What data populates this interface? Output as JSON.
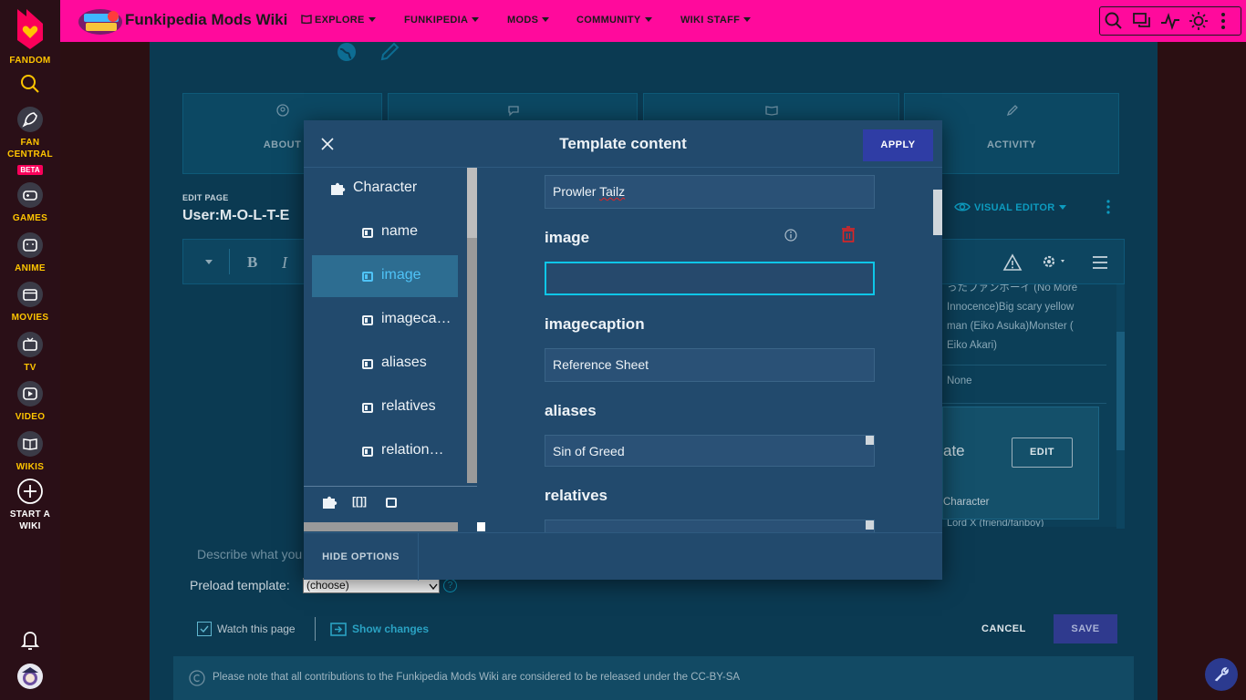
{
  "rail": {
    "fandom_label": "FANDOM",
    "fan_central_label": "FAN CENTRAL",
    "beta_badge": "BETA",
    "games_label": "GAMES",
    "anime_label": "ANIME",
    "movies_label": "MOVIES",
    "tv_label": "TV",
    "video_label": "VIDEO",
    "wikis_label": "WIKIS",
    "start_wiki_label_1": "START A",
    "start_wiki_label_2": "WIKI"
  },
  "header": {
    "wiki_title": "Funkipedia Mods Wiki",
    "nav": [
      "EXPLORE",
      "FUNKIPEDIA",
      "MODS",
      "COMMUNITY",
      "WIKI STAFF"
    ]
  },
  "page": {
    "tabs": [
      "ABOUT",
      "",
      "",
      "ACTIVITY"
    ],
    "edit_page_label": "EDIT PAGE",
    "edit_page_title": "User:M-O-L-T-E",
    "visual_editor": "VISUAL EDITOR",
    "right_text_lines": [
      "ったファンボーイ (No More",
      "Innocence)Big scary yellow",
      "man (Eiko Asuka)Monster (",
      "Eiko Akari)"
    ],
    "right_none": "None",
    "template_card_text": "ate",
    "template_card_edit": "EDIT",
    "template_card_sub": "Character",
    "right_footer_text": "Lord X (friend/fanboy)",
    "summary_placeholder": "Describe what you",
    "preload_label": "Preload template:",
    "preload_value": "(choose)",
    "watch_label": "Watch this page",
    "show_changes": "Show changes",
    "cancel": "CANCEL",
    "save": "SAVE",
    "license": "Please note that all contributions to the Funkipedia Mods Wiki are considered to be released under the CC-BY-SA"
  },
  "modal": {
    "title": "Template content",
    "apply": "APPLY",
    "outline": {
      "template": "Character",
      "params": [
        "name",
        "image",
        "imageca…",
        "aliases",
        "relatives",
        "relation…"
      ],
      "active_index": 1
    },
    "fields": {
      "name_value": "Prowler Tailz",
      "image_label": "image",
      "image_value": "",
      "imagecaption_label": "imagecaption",
      "imagecaption_value": "Reference Sheet",
      "aliases_label": "aliases",
      "aliases_value": "Sin of Greed",
      "relatives_label": "relatives"
    },
    "hide_options": "HIDE OPTIONS"
  },
  "colors": {
    "brand_pink": "#ff0a9c",
    "accent_gold": "#ffc500",
    "page_bg": "#0b3a52",
    "modal_bg": "#224a6d",
    "focus_cyan": "#0ec6e8",
    "delete_red": "#e02424"
  }
}
